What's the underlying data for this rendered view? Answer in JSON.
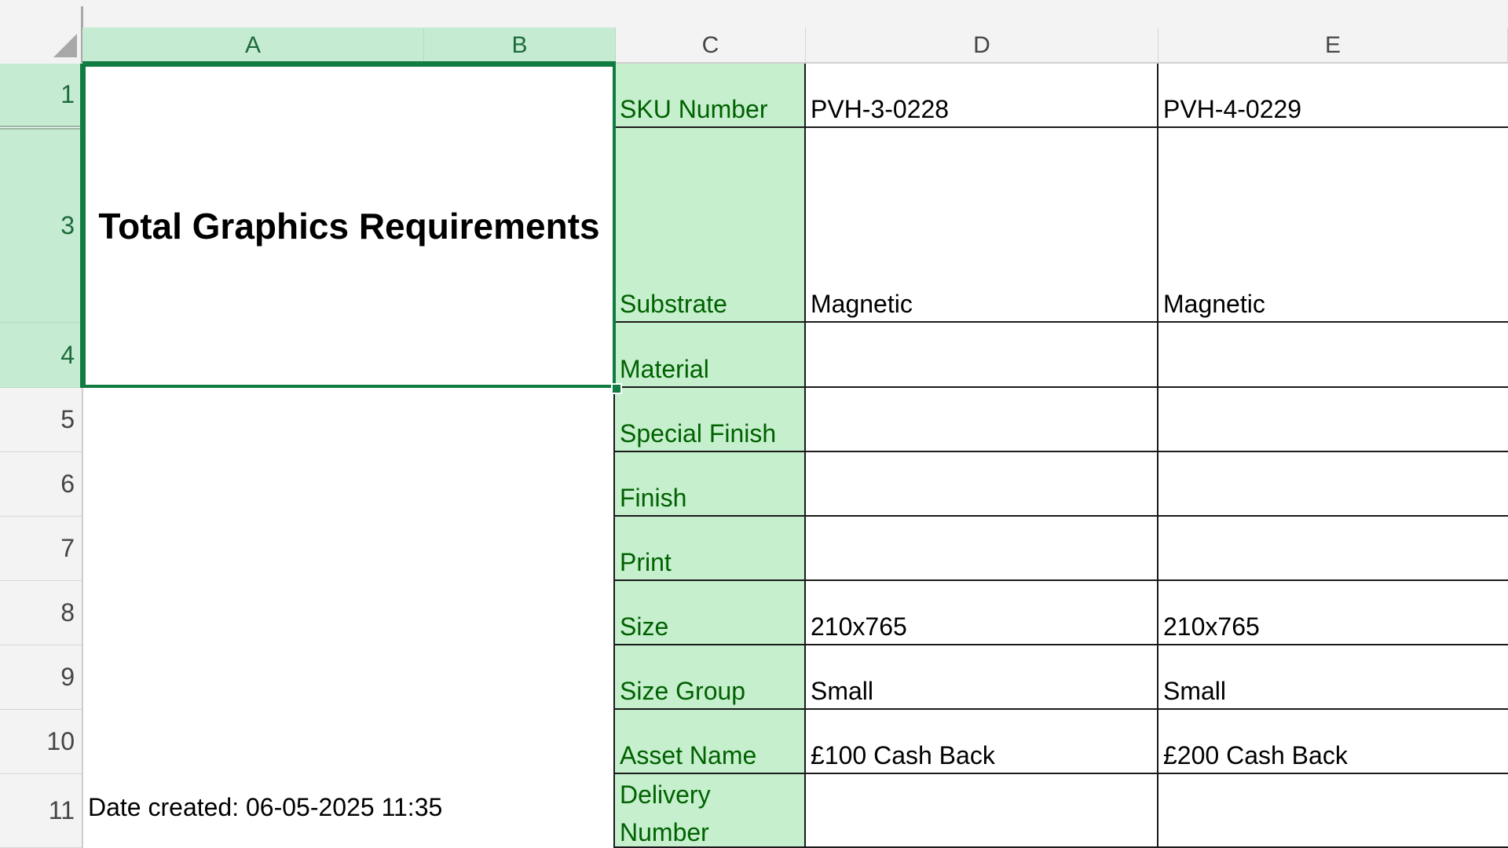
{
  "columns": [
    "A",
    "B",
    "C",
    "D",
    "E"
  ],
  "rows": [
    "1",
    "3",
    "4",
    "5",
    "6",
    "7",
    "8",
    "9",
    "10",
    "11"
  ],
  "title": "Total Graphics Requirements",
  "date_created": "Date created: 06-05-2025 11:35",
  "labels": {
    "sku": "SKU Number",
    "substrate": "Substrate",
    "material": "Material",
    "special_finish": "Special Finish",
    "finish": "Finish",
    "print": "Print",
    "size": "Size",
    "size_group": "Size Group",
    "asset_name": "Asset Name",
    "delivery_number": "Delivery Number"
  },
  "col_d": {
    "sku": "PVH-3-0228",
    "substrate": "Magnetic",
    "material": "",
    "special_finish": "",
    "finish": "",
    "print": "",
    "size": "210x765",
    "size_group": "Small",
    "asset_name": "£100 Cash Back",
    "delivery_number": ""
  },
  "col_e": {
    "sku": "PVH-4-0229",
    "substrate": "Magnetic",
    "material": "",
    "special_finish": "",
    "finish": "",
    "print": "",
    "size": "210x765",
    "size_group": "Small",
    "asset_name": "£200 Cash Back",
    "delivery_number": ""
  },
  "colors": {
    "selection": "#107c41",
    "label_fill": "#c6efce",
    "label_text": "#006100",
    "header_selected_fill": "#c6ebd3"
  }
}
